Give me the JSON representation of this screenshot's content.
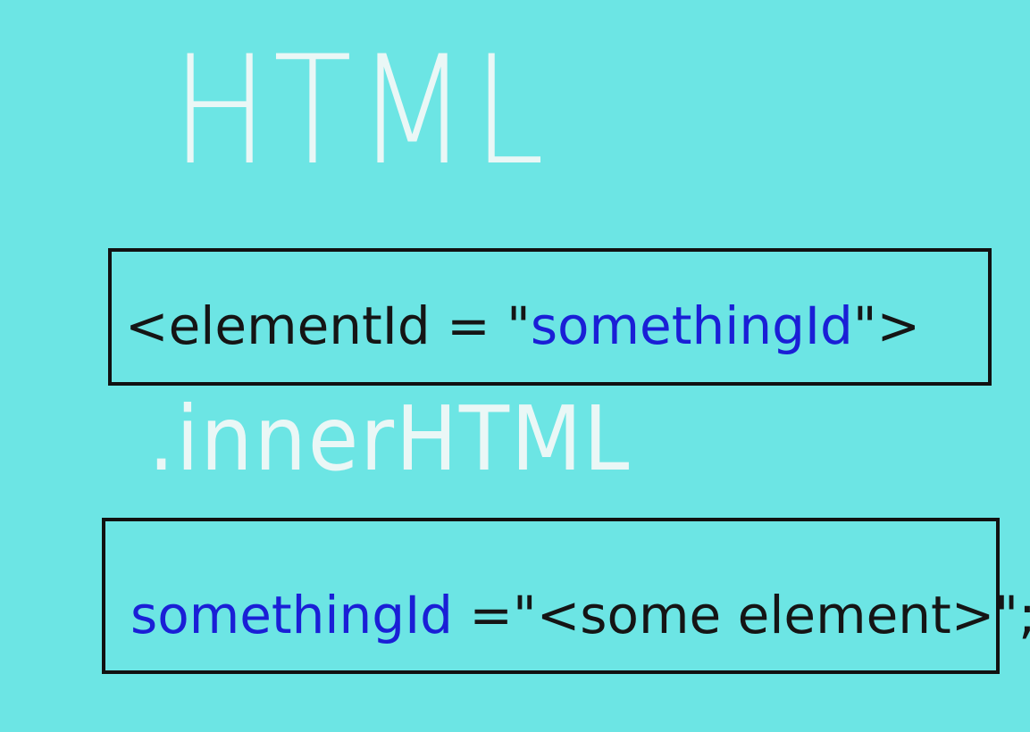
{
  "heading": "HTML",
  "box1": {
    "prefix": "<elementId = \"",
    "highlight": "somethingId",
    "suffix": "\">"
  },
  "property": ".innerHTML",
  "box2": {
    "highlight": "somethingId",
    "suffix": " =\"<some element>\";"
  },
  "colors": {
    "background": "#6ce5e4",
    "handwriting_white": "#eaf7f6",
    "code_black": "#151515",
    "code_blue": "#1a1fd6",
    "border": "#111111"
  }
}
